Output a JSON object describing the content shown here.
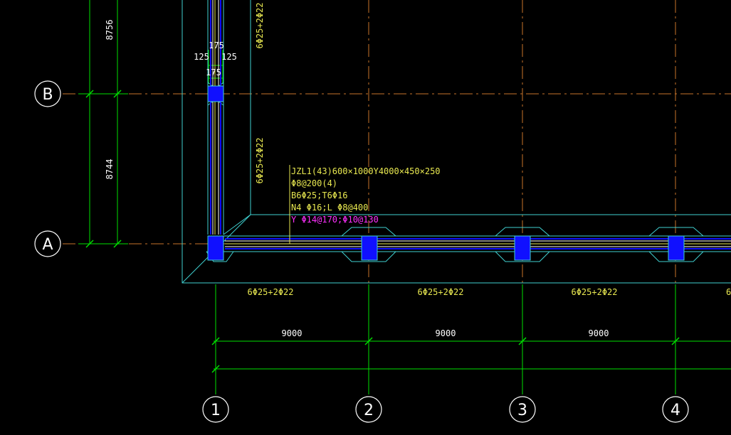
{
  "grid_axes": {
    "rows": [
      {
        "label": "B",
        "name": "axis-bubble-B"
      },
      {
        "label": "A",
        "name": "axis-bubble-A"
      }
    ],
    "columns": [
      {
        "label": "1",
        "name": "axis-bubble-1"
      },
      {
        "label": "2",
        "name": "axis-bubble-2"
      },
      {
        "label": "3",
        "name": "axis-bubble-3"
      },
      {
        "label": "4",
        "name": "axis-bubble-4"
      }
    ]
  },
  "dimensions": {
    "vertical": [
      "8756",
      "8744"
    ],
    "horizontal": [
      "9000",
      "9000",
      "9000"
    ],
    "column_width": {
      "left": "125",
      "right": "125",
      "top": "175",
      "bottom": "175"
    }
  },
  "beam_annotation": {
    "line1": "JZL1(43)600×1000Y4000×450×250",
    "line2": "Φ8@200(4)",
    "line3": "B6Φ25;T6Φ16",
    "line4": "N4 Φ16;L Φ8@400",
    "line5": "Y Φ14@170;Φ10@130"
  },
  "rebar_labels": {
    "vertical_top": "6Φ25+2Φ22",
    "vertical_mid": "6Φ25+2Φ22",
    "bottom": [
      "6Φ25+2Φ22",
      "6Φ25+2Φ22",
      "6Φ25+2Φ22",
      "6"
    ]
  },
  "colors": {
    "background": "#000000",
    "grid_line": "#c8742a",
    "dimension": "#00e000",
    "beam_outline": "#3fd0d0",
    "column_fill": "#1010ff",
    "annotation": "#e8e850",
    "annotation_magenta": "#ff30ff",
    "bubble": "#ffffff"
  }
}
